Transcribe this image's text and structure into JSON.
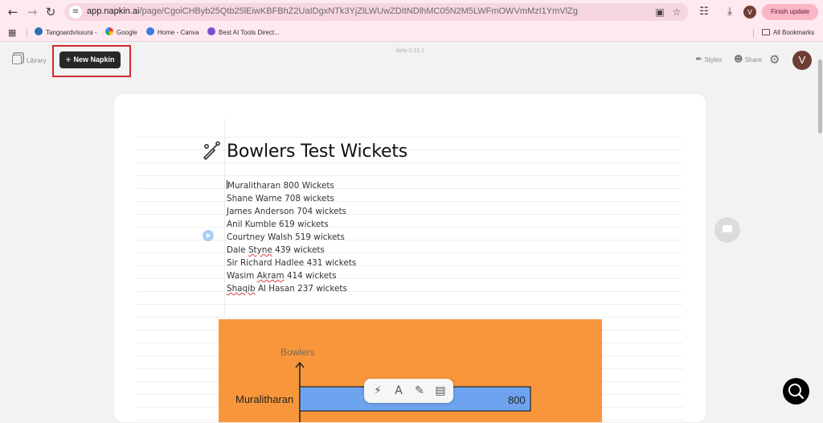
{
  "browser": {
    "url_host": "app.napkin.ai",
    "url_path": "/page/CgoiCHByb25Qtb25lEiwKBFBhZ2UaIDgxNTk3YjZlLWUwZDItNDlhMC05N2M5LWFmOWVmMzI1YmVlZg",
    "profile_initial": "V",
    "finish_update_label": "Finish update",
    "bookmarks": [
      "Tangoardvissura -",
      "Google",
      "Home - Canva",
      "Best AI Tools Direct..."
    ],
    "all_bookmarks_label": "All Bookmarks"
  },
  "topbar": {
    "library_label": "Library",
    "new_napkin_label": "New Napkin",
    "version": "beta 0.12.1",
    "styles_label": "Styles",
    "share_label": "Share",
    "avatar_initial": "V"
  },
  "document": {
    "title": "Bowlers Test Wickets",
    "lines": [
      {
        "name": "Muralitharan",
        "rest": " 800 Wickets",
        "spell": false
      },
      {
        "name": "Shane Warne",
        "rest": " 708 wickets",
        "spell": false
      },
      {
        "name": "James Anderson",
        "rest": " 704 wickets",
        "spell": false
      },
      {
        "name": "Anil Kumble",
        "rest": " 619 wickets",
        "spell": false
      },
      {
        "name": "Courtney Walsh",
        "rest": " 519 wickets",
        "spell": false
      },
      {
        "pre": "Dale ",
        "name": "Styne",
        "rest": " 439 wickets",
        "spell": true
      },
      {
        "name": "Sir Richard Hadlee",
        "rest": " 431 wickets",
        "spell": false
      },
      {
        "pre": "Wasim ",
        "name": "Akram",
        "rest": " 414 wickets",
        "spell": true
      },
      {
        "pre": "",
        "name": "Shaqib",
        "rest": " Al Hasan 237 wickets",
        "spell": true
      }
    ]
  },
  "visual": {
    "background": "#f7963b",
    "axis_label": "Bowlers",
    "bar_label": "Muralitharan",
    "bar_value": "800",
    "bar_color": "#6ea3f0"
  }
}
